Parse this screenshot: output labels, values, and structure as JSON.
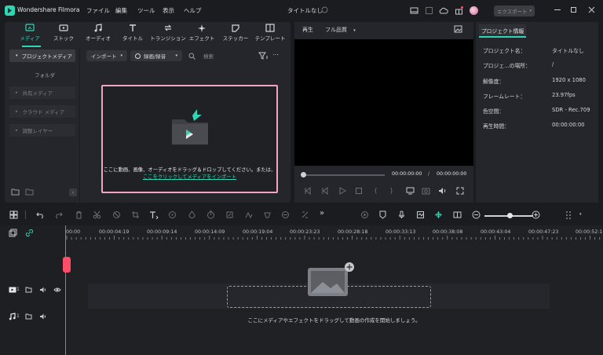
{
  "app": {
    "name": "Wondershare Filmora",
    "project_title": "タイトルなし",
    "export_label": "エクスポート"
  },
  "menu": [
    "ファイル",
    "編集",
    "ツール",
    "表示",
    "ヘルプ"
  ],
  "media_tabs": [
    "メディア",
    "ストック",
    "オーディオ",
    "タイトル",
    "トランジション",
    "エフェクト",
    "ステッカー",
    "テンプレート"
  ],
  "sidebar": {
    "items": [
      "プロジェクトメディア",
      "フォルダ",
      "共有メディア",
      "クラウド メディア",
      "調整レイヤー"
    ]
  },
  "media_toolbar": {
    "import_label": "インポート",
    "record_label": "録画/録音",
    "search_placeholder": "検索"
  },
  "dropzone": {
    "line1": "ここに動画、画像、オーディオをドラッグ＆ドロップしてください。または、",
    "line2": "ここをクリックしてメディアをインポート"
  },
  "preview": {
    "play_label": "再生",
    "quality_label": "フル品質",
    "current_time": "00:00:00:00",
    "total_time": "00:00:00:00"
  },
  "properties": {
    "tab_label": "プロジェクト情報",
    "rows": [
      {
        "label": "プロジェクト名：",
        "value": "タイトルなし"
      },
      {
        "label": "プロジェ...の場所：",
        "value": "/"
      },
      {
        "label": "解像度：",
        "value": "1920 x 1080"
      },
      {
        "label": "フレームレート：",
        "value": "23.97fps"
      },
      {
        "label": "色空間：",
        "value": "SDR - Rec.709"
      },
      {
        "label": "再生時間：",
        "value": "00:00:00:00"
      }
    ]
  },
  "timeline": {
    "ruler": [
      "00:00",
      "00:00:04:19",
      "00:00:09:14",
      "00:00:14:09",
      "00:00:19:04",
      "00:00:23:23",
      "00:00:28:18",
      "00:00:33:13",
      "00:00:38:08",
      "00:00:43:04",
      "00:00:47:23",
      "00:00:52:1"
    ],
    "video_track_num": "1",
    "audio_track_num": "1",
    "hint": "ここにメディアやエフェクトをドラッグして動画の作成を開始しましょう。"
  },
  "colors": {
    "accent": "#2fd6b4",
    "dropzone_border": "#f1a5c0",
    "playhead": "#ff4d6a"
  }
}
